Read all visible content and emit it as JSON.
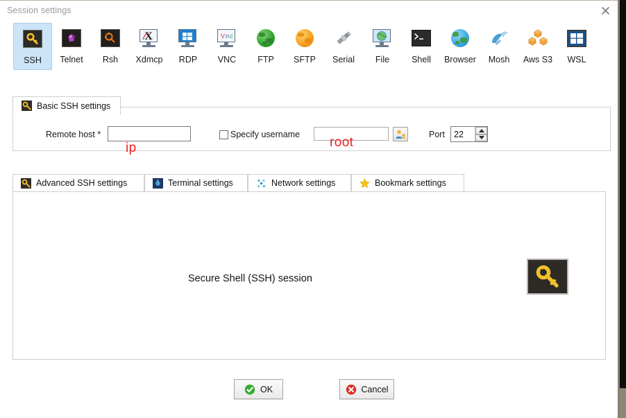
{
  "window": {
    "title": "Session settings",
    "close_icon": "close-icon"
  },
  "protocols": [
    {
      "id": "ssh",
      "label": "SSH",
      "icon": "key-icon",
      "selected": true
    },
    {
      "id": "telnet",
      "label": "Telnet",
      "icon": "gem-icon",
      "selected": false
    },
    {
      "id": "rsh",
      "label": "Rsh",
      "icon": "gear-dark-icon",
      "selected": false
    },
    {
      "id": "xdmcp",
      "label": "Xdmcp",
      "icon": "x-monitor-icon",
      "selected": false
    },
    {
      "id": "rdp",
      "label": "RDP",
      "icon": "windows-monitor-icon",
      "selected": false
    },
    {
      "id": "vnc",
      "label": "VNC",
      "icon": "vnc-monitor-icon",
      "selected": false
    },
    {
      "id": "ftp",
      "label": "FTP",
      "icon": "green-globe-icon",
      "selected": false
    },
    {
      "id": "sftp",
      "label": "SFTP",
      "icon": "orange-globe-icon",
      "selected": false
    },
    {
      "id": "serial",
      "label": "Serial",
      "icon": "serial-plug-icon",
      "selected": false
    },
    {
      "id": "file",
      "label": "File",
      "icon": "file-monitor-icon",
      "selected": false
    },
    {
      "id": "shell",
      "label": "Shell",
      "icon": "terminal-icon",
      "selected": false
    },
    {
      "id": "browser",
      "label": "Browser",
      "icon": "blue-globe-icon",
      "selected": false
    },
    {
      "id": "mosh",
      "label": "Mosh",
      "icon": "satellite-icon",
      "selected": false
    },
    {
      "id": "awss3",
      "label": "Aws S3",
      "icon": "aws-s3-icon",
      "selected": false
    },
    {
      "id": "wsl",
      "label": "WSL",
      "icon": "windows-icon",
      "selected": false
    }
  ],
  "basic_settings": {
    "tab_label": "Basic SSH settings",
    "tab_icon": "key-icon",
    "remote_host": {
      "label": "Remote host *",
      "value": "",
      "placeholder": ""
    },
    "specify_username": {
      "label": "Specify username",
      "checked": false,
      "value": "",
      "placeholder": "",
      "browse_icon": "user-icon"
    },
    "port": {
      "label": "Port",
      "value": "22",
      "up_icon": "chevron-up-icon",
      "down_icon": "chevron-down-icon"
    }
  },
  "annotations": [
    {
      "id": "annot-ip",
      "text": "ip"
    },
    {
      "id": "annot-root",
      "text": "root"
    }
  ],
  "tabs": [
    {
      "id": "advanced-ssh",
      "label": "Advanced SSH settings",
      "icon": "key-icon",
      "active": true
    },
    {
      "id": "terminal",
      "label": "Terminal settings",
      "icon": "terminal-blue-icon",
      "active": false
    },
    {
      "id": "network",
      "label": "Network settings",
      "icon": "network-dots-icon",
      "active": false
    },
    {
      "id": "bookmark",
      "label": "Bookmark settings",
      "icon": "star-icon",
      "active": false
    }
  ],
  "panel": {
    "text": "Secure Shell (SSH) session",
    "icon": "key-large-icon"
  },
  "buttons": {
    "ok": {
      "label": "OK",
      "icon": "check-circle-icon"
    },
    "cancel": {
      "label": "Cancel",
      "icon": "x-circle-icon"
    }
  },
  "colors": {
    "selected_tile_bg": "#cce4f7",
    "selected_tile_border": "#a9ccea",
    "annotation_red": "#ef2020",
    "ok_green": "#3aaa35",
    "cancel_red": "#d93025",
    "key_yellow": "#f2c029",
    "panel_border": "#cfcfcf"
  }
}
